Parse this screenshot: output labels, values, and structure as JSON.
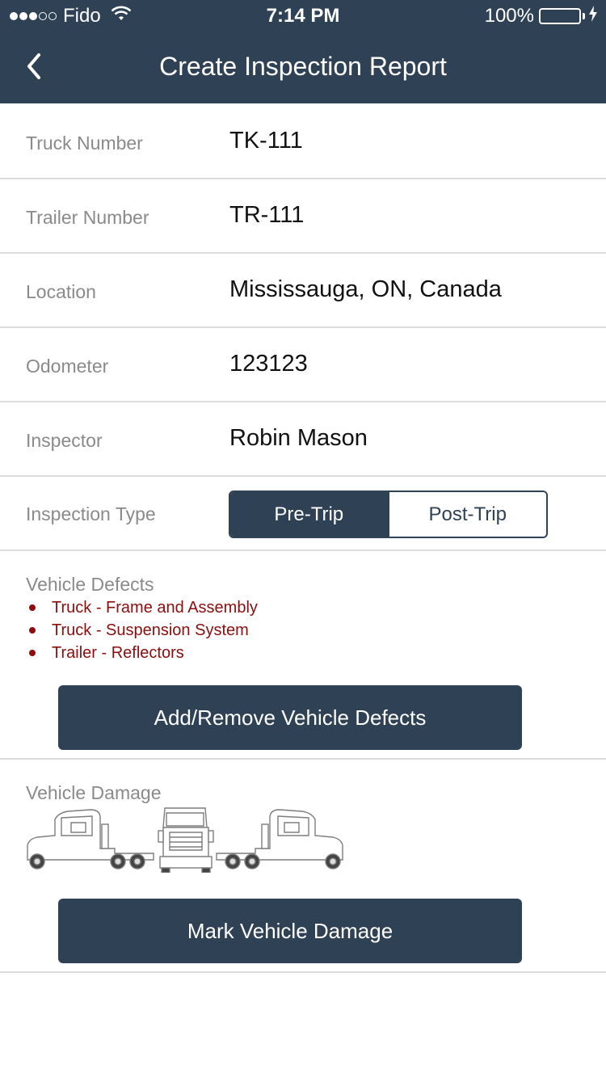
{
  "status_bar": {
    "carrier": "Fido",
    "time": "7:14 PM",
    "battery": "100%",
    "signal_bars_filled": 3,
    "signal_bars_total": 5
  },
  "nav": {
    "title": "Create Inspection Report",
    "back_icon": "chevron-left-icon"
  },
  "form": {
    "truck_number": {
      "label": "Truck Number",
      "value": "TK-111"
    },
    "trailer_number": {
      "label": "Trailer Number",
      "value": "TR-111"
    },
    "location": {
      "label": "Location",
      "value": "Mississauga, ON, Canada"
    },
    "odometer": {
      "label": "Odometer",
      "value": "123123"
    },
    "inspector": {
      "label": "Inspector",
      "value": "Robin Mason"
    },
    "inspection_type": {
      "label": "Inspection Type",
      "options": [
        "Pre-Trip",
        "Post-Trip"
      ],
      "selected": "Pre-Trip"
    }
  },
  "defects": {
    "label": "Vehicle Defects",
    "items": [
      "Truck - Frame and Assembly",
      "Truck - Suspension System",
      "Trailer - Reflectors"
    ],
    "button_label": "Add/Remove Vehicle Defects"
  },
  "damage": {
    "label": "Vehicle Damage",
    "views": [
      "truck-left-side-icon",
      "truck-front-icon",
      "truck-right-side-icon"
    ],
    "button_label": "Mark Vehicle Damage"
  },
  "colors": {
    "primary": "#2f4154",
    "defect_text": "#8b0d0d",
    "battery": "#4cd964",
    "label": "#8a8a8a",
    "divider": "#dcdcdc"
  }
}
